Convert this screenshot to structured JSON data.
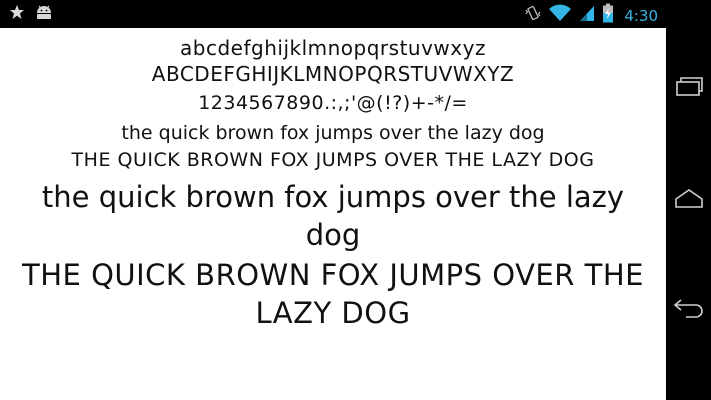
{
  "status_bar": {
    "time": "4:30",
    "icons": [
      "star-icon",
      "android-icon",
      "vibrate-icon",
      "wifi-icon",
      "signal-icon",
      "battery-charging-icon"
    ],
    "clock_color": "#33b5e5"
  },
  "content": {
    "samples": [
      "abcdefghijklmnopqrstuvwxyz",
      "ABCDEFGHIJKLMNOPQRSTUVWXYZ",
      "1234567890.:,;'@(!?)+-*/=",
      "the quick brown fox jumps over the lazy dog",
      "THE QUICK BROWN FOX JUMPS OVER THE LAZY DOG",
      "the quick brown fox jumps over the lazy dog",
      "THE QUICK BROWN FOX JUMPS OVER THE LAZY DOG"
    ]
  },
  "nav_bar": {
    "buttons": [
      "recent-apps-icon",
      "home-icon",
      "back-icon"
    ]
  }
}
